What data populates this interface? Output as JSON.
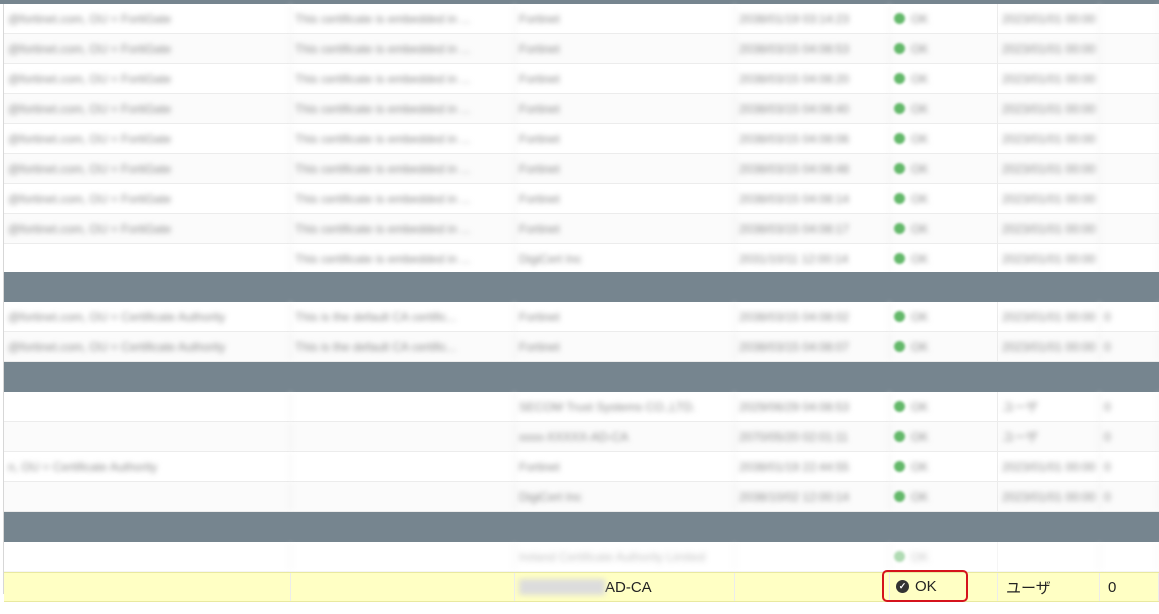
{
  "rows": [
    {
      "c1": "@fortinet.com, OU = FortiGate",
      "c2": "This certificate is embedded in ...",
      "c3": "Fortinet",
      "c4": "2038/01/19 03:14:23",
      "c5": "OK",
      "c6": "2023/01/01 00:00",
      "c7": ""
    },
    {
      "c1": "@fortinet.com, OU = FortiGate",
      "c2": "This certificate is embedded in ...",
      "c3": "Fortinet",
      "c4": "2038/03/15 04:08:53",
      "c5": "OK",
      "c6": "2023/01/01 00:00",
      "c7": ""
    },
    {
      "c1": "@fortinet.com, OU = FortiGate",
      "c2": "This certificate is embedded in ...",
      "c3": "Fortinet",
      "c4": "2038/03/15 04:08:20",
      "c5": "OK",
      "c6": "2023/01/01 00:00",
      "c7": ""
    },
    {
      "c1": "@fortinet.com, OU = FortiGate",
      "c2": "This certificate is embedded in ...",
      "c3": "Fortinet",
      "c4": "2038/03/15 04:08:40",
      "c5": "OK",
      "c6": "2023/01/01 00:00",
      "c7": ""
    },
    {
      "c1": "@fortinet.com, OU = FortiGate",
      "c2": "This certificate is embedded in ...",
      "c3": "Fortinet",
      "c4": "2038/03/15 04:08:06",
      "c5": "OK",
      "c6": "2023/01/01 00:00",
      "c7": ""
    },
    {
      "c1": "@fortinet.com, OU = FortiGate",
      "c2": "This certificate is embedded in ...",
      "c3": "Fortinet",
      "c4": "2038/03/15 04:08:48",
      "c5": "OK",
      "c6": "2023/01/01 00:00",
      "c7": ""
    },
    {
      "c1": "@fortinet.com, OU = FortiGate",
      "c2": "This certificate is embedded in ...",
      "c3": "Fortinet",
      "c4": "2038/03/15 04:08:14",
      "c5": "OK",
      "c6": "2023/01/01 00:00",
      "c7": ""
    },
    {
      "c1": "@fortinet.com, OU = FortiGate",
      "c2": "This certificate is embedded in ...",
      "c3": "Fortinet",
      "c4": "2038/03/15 04:08:17",
      "c5": "OK",
      "c6": "2023/01/01 00:00",
      "c7": ""
    },
    {
      "c1": "",
      "c2": "This certificate is embedded in ...",
      "c3": "DigiCert Inc",
      "c4": "2031/10/11 12:00:14",
      "c5": "OK",
      "c6": "2023/01/01 00:00",
      "c7": ""
    },
    {
      "c1": "@fortinet.com, OU = Certificate Authority",
      "c2": "This is the default CA certific...",
      "c3": "Fortinet",
      "c4": "2038/03/15 04:08:02",
      "c5": "OK",
      "c6": "2023/01/01 00:00",
      "c7": "0"
    },
    {
      "c1": "@fortinet.com, OU = Certificate Authority",
      "c2": "This is the default CA certific...",
      "c3": "Fortinet",
      "c4": "2038/03/15 04:08:07",
      "c5": "OK",
      "c6": "2023/01/01 00:00",
      "c7": "0"
    },
    {
      "c1": "",
      "c2": "",
      "c3": "SECOM Trust Systems CO.,LTD.",
      "c4": "2029/06/29 04:08:53",
      "c5": "OK",
      "c6": "ユーザ",
      "c7": "0"
    },
    {
      "c1": "",
      "c2": "",
      "c3": "xxxx-XXXXX-AD-CA",
      "c4": "2070/05/20 02:01:11",
      "c5": "OK",
      "c6": "ユーザ",
      "c7": "0"
    },
    {
      "c1": "n, OU = Certificate Authority",
      "c2": "",
      "c3": "Fortinet",
      "c4": "2038/01/19 22:44:55",
      "c5": "OK",
      "c6": "2023/01/01 00:00",
      "c7": "0"
    },
    {
      "c1": "",
      "c2": "",
      "c3": "DigiCert Inc",
      "c4": "2038/10/02 12:00:14",
      "c5": "OK",
      "c6": "2023/01/01 00:00",
      "c7": "0"
    },
    {
      "c1": "",
      "c2": "",
      "c3": "Ireland Certificate Authority Limited",
      "c4": "",
      "c5": "OK",
      "c6": "",
      "c7": ""
    }
  ],
  "selected_row": {
    "issuer_suffix": "AD-CA",
    "status": "OK",
    "source": "ユーザ",
    "refs": "0"
  },
  "colors": {
    "group_header": "#76858f",
    "selected_row": "#ffffc4",
    "status_ok": "#63b86a",
    "highlight_box": "#d5131c"
  },
  "icons": {
    "status_ok": "green-dot-icon",
    "selected_status": "check-circle-icon"
  }
}
